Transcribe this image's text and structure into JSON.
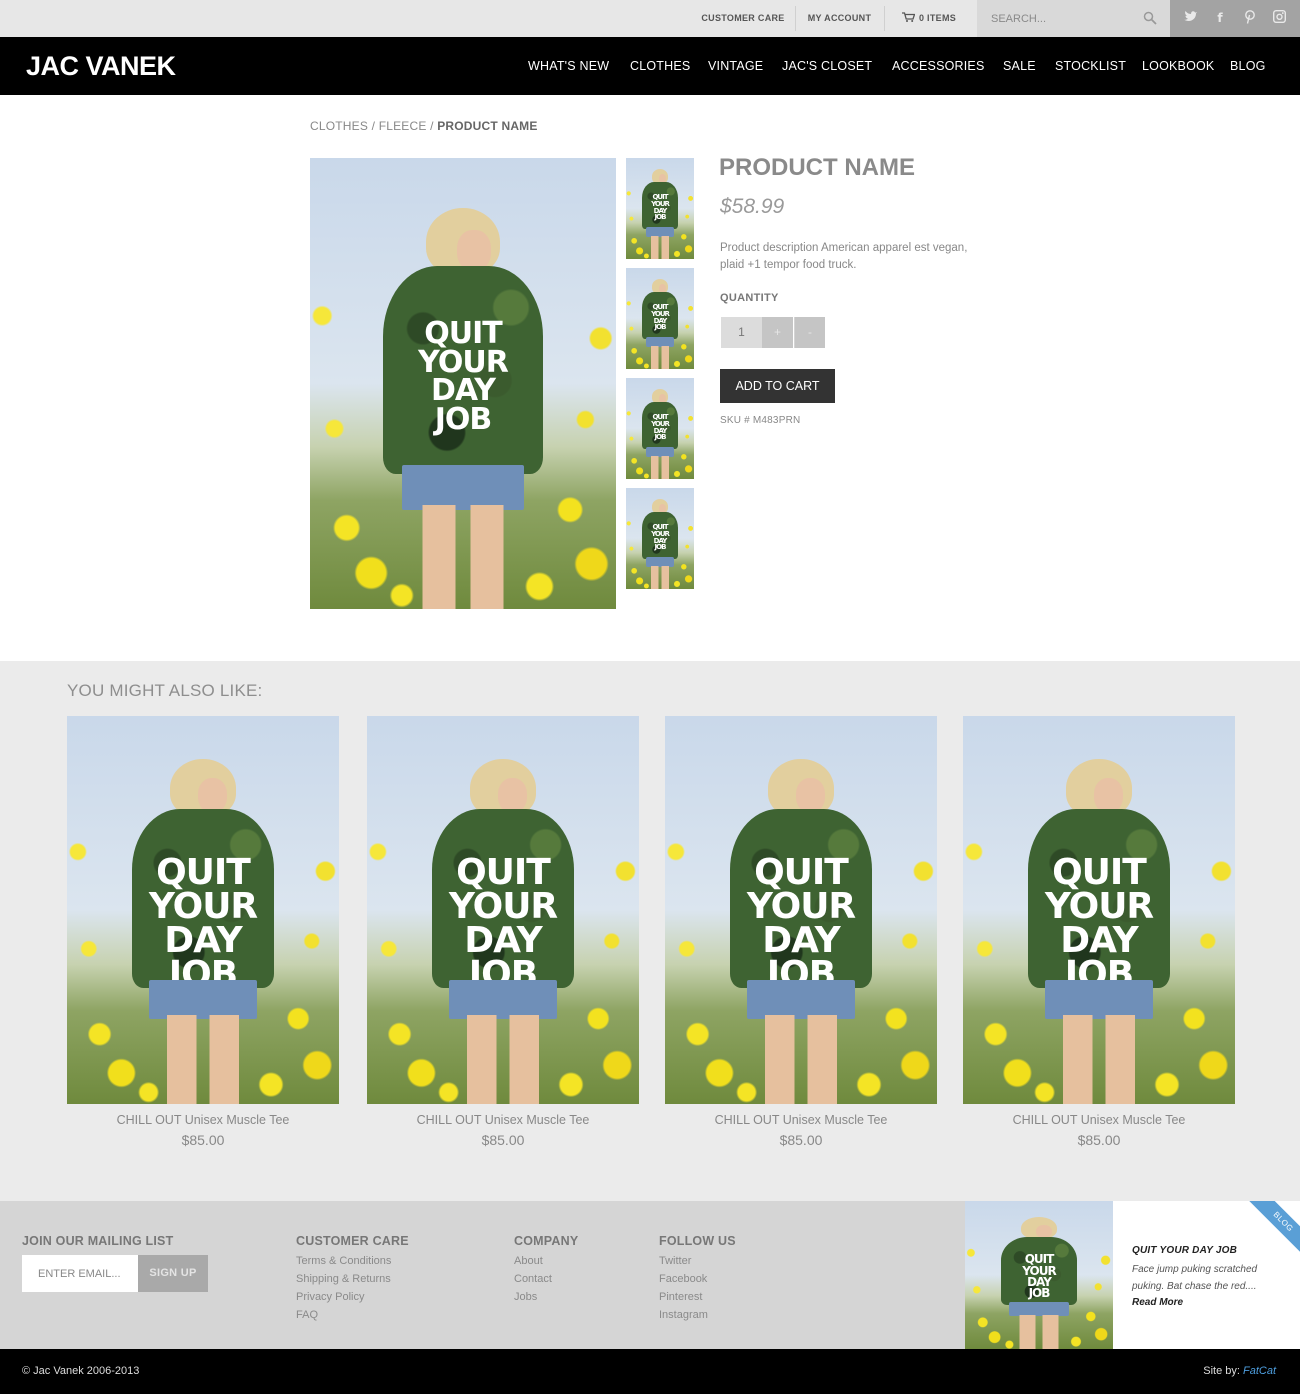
{
  "topbar": {
    "customer_care": "CUSTOMER CARE",
    "my_account": "MY ACCOUNT",
    "cart_label": "0 ITEMS",
    "search_placeholder": "SEARCH...",
    "social_icons": [
      "twitter-icon",
      "facebook-icon",
      "pinterest-icon",
      "instagram-icon"
    ]
  },
  "header": {
    "logo": "JAC VANEK",
    "nav": [
      "WHAT'S NEW",
      "CLOTHES",
      "VINTAGE",
      "JAC'S CLOSET",
      "ACCESSORIES",
      "SALE",
      "STOCKLIST",
      "LOOKBOOK",
      "BLOG"
    ]
  },
  "breadcrumb": {
    "level1": "CLOTHES",
    "sep": " / ",
    "level2": "FLEECE",
    "current": "PRODUCT NAME"
  },
  "product": {
    "image_text": [
      "QUIT",
      "YOUR",
      "DAY",
      "JOB"
    ],
    "title": "PRODUCT NAME",
    "price": "$58.99",
    "description": "Product description American apparel est vegan, plaid +1 tempor food truck.",
    "quantity_label": "QUANTITY",
    "quantity_value": "1",
    "plus": "+",
    "minus": "-",
    "add_to_cart": "ADD TO CART",
    "sku": "SKU # M483PRN"
  },
  "related": {
    "title": "YOU MIGHT ALSO LIKE:",
    "items": [
      {
        "name": "CHILL OUT Unisex Muscle Tee",
        "price": "$85.00"
      },
      {
        "name": "CHILL OUT Unisex Muscle Tee",
        "price": "$85.00"
      },
      {
        "name": "CHILL OUT Unisex Muscle Tee",
        "price": "$85.00"
      },
      {
        "name": "CHILL OUT Unisex Muscle Tee",
        "price": "$85.00"
      }
    ]
  },
  "footer": {
    "mailing": {
      "title": "JOIN OUR MAILING LIST",
      "placeholder": "ENTER EMAIL...",
      "button": "SIGN UP"
    },
    "customer_care": {
      "title": "CUSTOMER CARE",
      "links": [
        "Terms & Conditions",
        "Shipping & Returns",
        "Privacy Policy",
        "FAQ"
      ]
    },
    "company": {
      "title": "COMPANY",
      "links": [
        "About",
        "Contact",
        "Jobs"
      ]
    },
    "follow": {
      "title": "FOLLOW US",
      "links": [
        "Twitter",
        "Facebook",
        "Pinterest",
        "Instagram"
      ]
    },
    "blog": {
      "ribbon": "BLOG",
      "title": "QUIT YOUR DAY JOB",
      "excerpt": "Face jump puking scratched puking. Bat chase the red....",
      "more": "Read More"
    }
  },
  "bottombar": {
    "copyright": "© Jac Vanek 2006-2013",
    "credit_prefix": "Site by: ",
    "credit_brand": "FatCat"
  },
  "colors": {
    "accent_blue": "#4e9fe0",
    "header_bg": "#000000",
    "button_dark": "#333333"
  }
}
